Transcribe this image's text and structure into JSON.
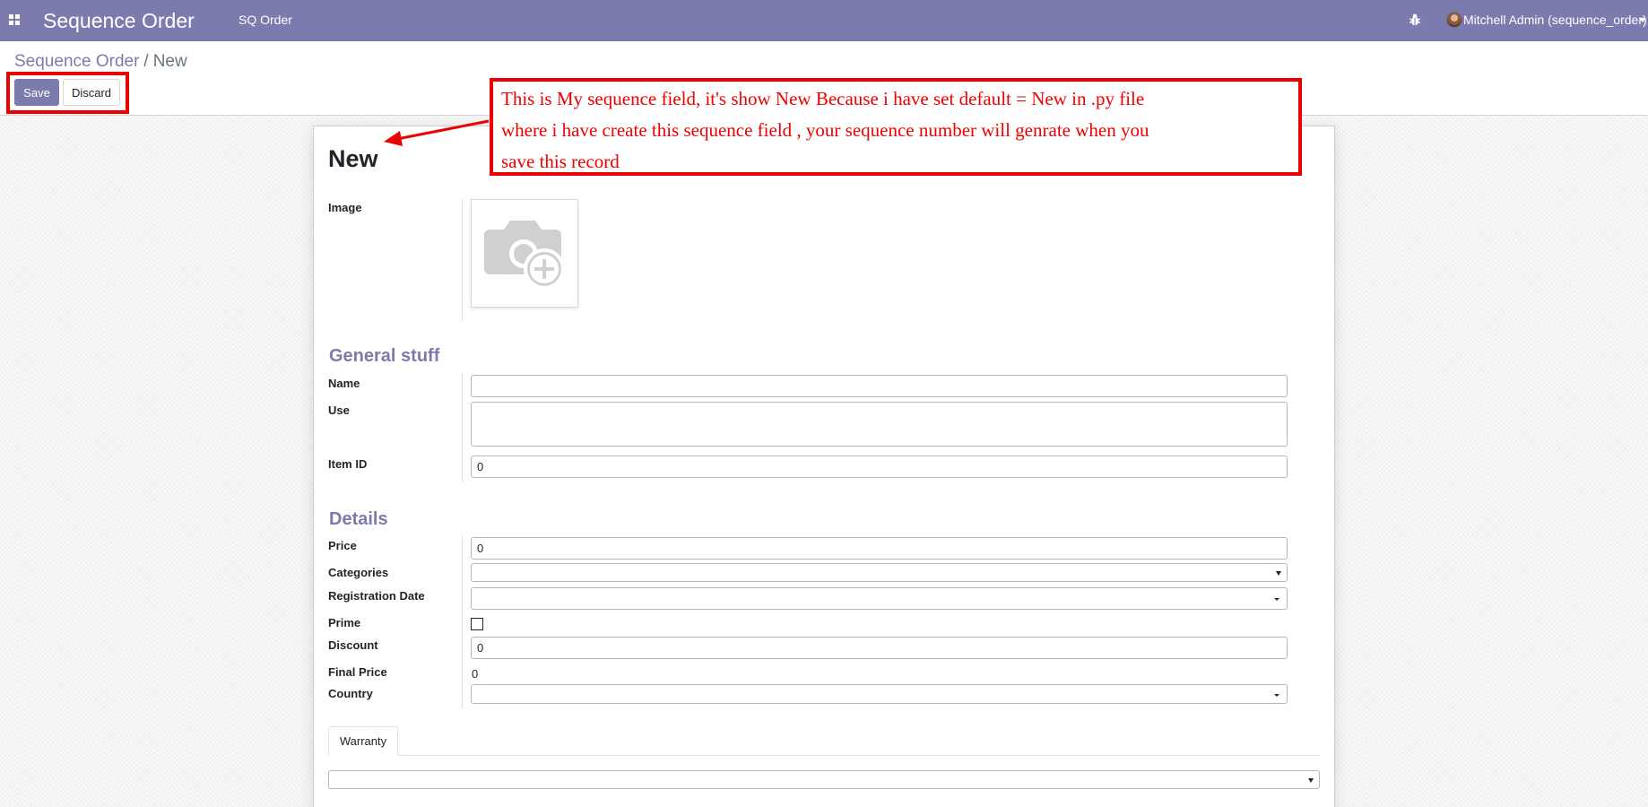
{
  "navbar": {
    "app_title": "Sequence Order",
    "menu_item": "SQ Order",
    "user_name": "Mitchell Admin (sequence_order)",
    "bg_color": "#7c7bad",
    "icons": [
      "apps-grid-icon",
      "bug-icon",
      "avatar",
      "caret-down-icon"
    ]
  },
  "breadcrumb": {
    "parent": "Sequence Order",
    "separator": "/",
    "current": "New"
  },
  "buttons": {
    "save": "Save",
    "discard": "Discard"
  },
  "form": {
    "title": "New",
    "image_label": "Image",
    "image_icon": "camera-plus-icon",
    "sections": {
      "general": "General stuff",
      "details": "Details"
    },
    "fields": {
      "name": {
        "label": "Name",
        "value": ""
      },
      "use": {
        "label": "Use",
        "value": ""
      },
      "item_id": {
        "label": "Item ID",
        "value": "0"
      },
      "price": {
        "label": "Price",
        "value": "0"
      },
      "categories": {
        "label": "Categories",
        "value": ""
      },
      "registration_date": {
        "label": "Registration Date",
        "value": ""
      },
      "prime": {
        "label": "Prime",
        "checked": false
      },
      "discount": {
        "label": "Discount",
        "value": "0"
      },
      "final_price": {
        "label": "Final Price",
        "value": "0"
      },
      "country": {
        "label": "Country",
        "value": ""
      }
    },
    "tabs": [
      {
        "label": "Warranty",
        "active": true
      }
    ],
    "tab_select_value": ""
  },
  "annotation": {
    "lines": [
      "This is My sequence field,  it's  show New Because i have set  default = New  in .py file",
      "where i have create this sequence field , your sequence number will genrate when you",
      "save this record"
    ],
    "color": "#ee0000"
  }
}
